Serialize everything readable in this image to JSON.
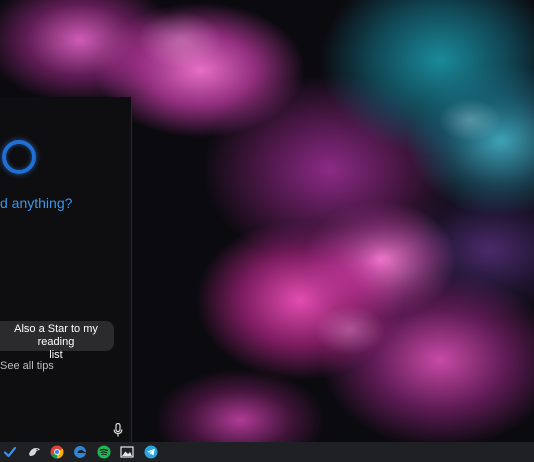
{
  "cortana": {
    "prompt": "d anything?",
    "tip_line1": "Also a Star to my reading",
    "tip_line2": "list",
    "see_all_tips": "See all tips"
  },
  "taskbar": {
    "icons": [
      "todo-check-icon",
      "bird-app-icon",
      "chrome-icon",
      "edge-icon",
      "spotify-icon",
      "photos-icon",
      "telegram-icon"
    ]
  },
  "colors": {
    "cortana_blue": "#1f6fd6",
    "prompt_blue": "#3b95e8",
    "panel_bg": "#0e0e10",
    "taskbar_bg": "#1f2024"
  }
}
